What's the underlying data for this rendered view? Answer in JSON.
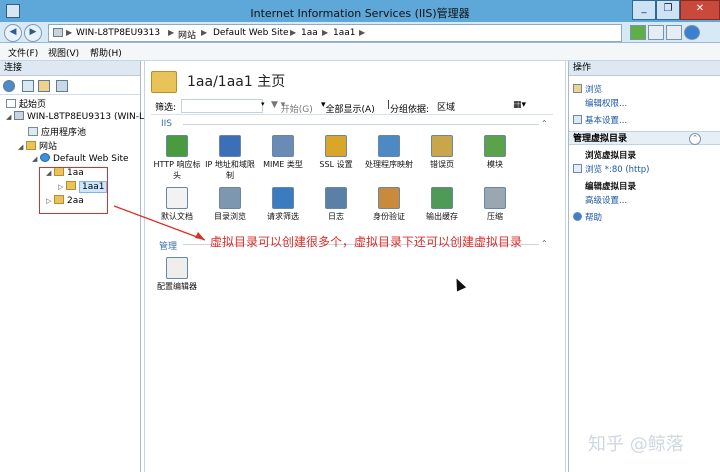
{
  "window": {
    "title": "Internet Information Services (IIS)管理器",
    "controls": [
      "_",
      "❐",
      "✕"
    ]
  },
  "address": {
    "crumbs": [
      "WIN-L8TP8EU9313",
      "网站",
      "Default Web Site",
      "1aa",
      "1aa1"
    ]
  },
  "menu": [
    "文件(F)",
    "视图(V)",
    "帮助(H)"
  ],
  "connections": {
    "header": "连接",
    "tree": [
      {
        "label": "起始页",
        "icon": "start-page-icon",
        "level": 0
      },
      {
        "label": "WIN-L8TP8EU9313 (WIN-L",
        "icon": "server-icon",
        "level": 0,
        "toggle": "◢"
      },
      {
        "label": "应用程序池",
        "icon": "app-pool-icon",
        "level": 1
      },
      {
        "label": "网站",
        "icon": "folder-icon",
        "level": 1,
        "toggle": "◢"
      },
      {
        "label": "Default Web Site",
        "icon": "globe-icon",
        "level": 2,
        "toggle": "◢"
      },
      {
        "label": "1aa",
        "icon": "folder-icon",
        "level": 3,
        "toggle": "◢"
      },
      {
        "label": "1aa1",
        "icon": "folder-icon",
        "level": 4,
        "toggle": "▷",
        "selected": true
      },
      {
        "label": "2aa",
        "icon": "folder-icon",
        "level": 3,
        "toggle": "▷"
      }
    ]
  },
  "main": {
    "title": "1aa/1aa1 主页",
    "filter": {
      "label": "筛选:",
      "start": "开始(G)",
      "show_all": "全部显示(A)",
      "group_by_label": "分组依据:",
      "group_by_value": "区域"
    },
    "groups": [
      {
        "name": "IIS",
        "features": [
          {
            "label": "HTTP 响应标头",
            "icon": "http-response-headers-icon",
            "color": "#4a9a3f"
          },
          {
            "label": "IP 地址和域限制",
            "icon": "ip-restrictions-icon",
            "color": "#3d6fb8"
          },
          {
            "label": "MIME 类型",
            "icon": "mime-types-icon",
            "color": "#6a8bb5"
          },
          {
            "label": "SSL 设置",
            "icon": "ssl-lock-icon",
            "color": "#d9a62a"
          },
          {
            "label": "处理程序映射",
            "icon": "handler-mappings-icon",
            "color": "#4d8ac4"
          },
          {
            "label": "错误页",
            "icon": "error-pages-icon",
            "color": "#c9a649"
          },
          {
            "label": "模块",
            "icon": "modules-icon",
            "color": "#5aa34a"
          },
          {
            "label": "默认文档",
            "icon": "default-document-icon",
            "color": "#f2f2f2"
          },
          {
            "label": "目录浏览",
            "icon": "directory-browsing-icon",
            "color": "#7d97b0"
          },
          {
            "label": "请求筛选",
            "icon": "request-filtering-icon",
            "color": "#3b7bbf"
          },
          {
            "label": "日志",
            "icon": "logging-icon",
            "color": "#5b7fa6"
          },
          {
            "label": "身份验证",
            "icon": "authentication-icon",
            "color": "#c98a3b"
          },
          {
            "label": "输出缓存",
            "icon": "output-caching-icon",
            "color": "#4f9a56"
          },
          {
            "label": "压缩",
            "icon": "compression-icon",
            "color": "#9aa6b0"
          }
        ]
      },
      {
        "name": "管理",
        "features": [
          {
            "label": "配置编辑器",
            "icon": "configuration-editor-icon",
            "color": "#eeeeee"
          }
        ]
      }
    ],
    "annotation": "虚拟目录可以创建很多个，虚拟目录下还可以创建虚拟目录"
  },
  "actions": {
    "header": "操作",
    "items1": [
      {
        "label": "浏览",
        "icon": "explore-icon"
      },
      {
        "label": "编辑权限...",
        "icon": ""
      },
      {
        "label": "基本设置...",
        "icon": "basic-settings-icon"
      }
    ],
    "section2": "管理虚拟目录",
    "items2": [
      {
        "label": "浏览虚拟目录",
        "plain": true
      },
      {
        "label": "浏览 *:80 (http)",
        "icon": "browse-icon"
      },
      {
        "label": "编辑虚拟目录",
        "plain": true
      },
      {
        "label": "高级设置...",
        "icon": ""
      },
      {
        "label": "帮助",
        "icon": "help-icon"
      }
    ]
  },
  "watermark": "知乎 @鲸落"
}
